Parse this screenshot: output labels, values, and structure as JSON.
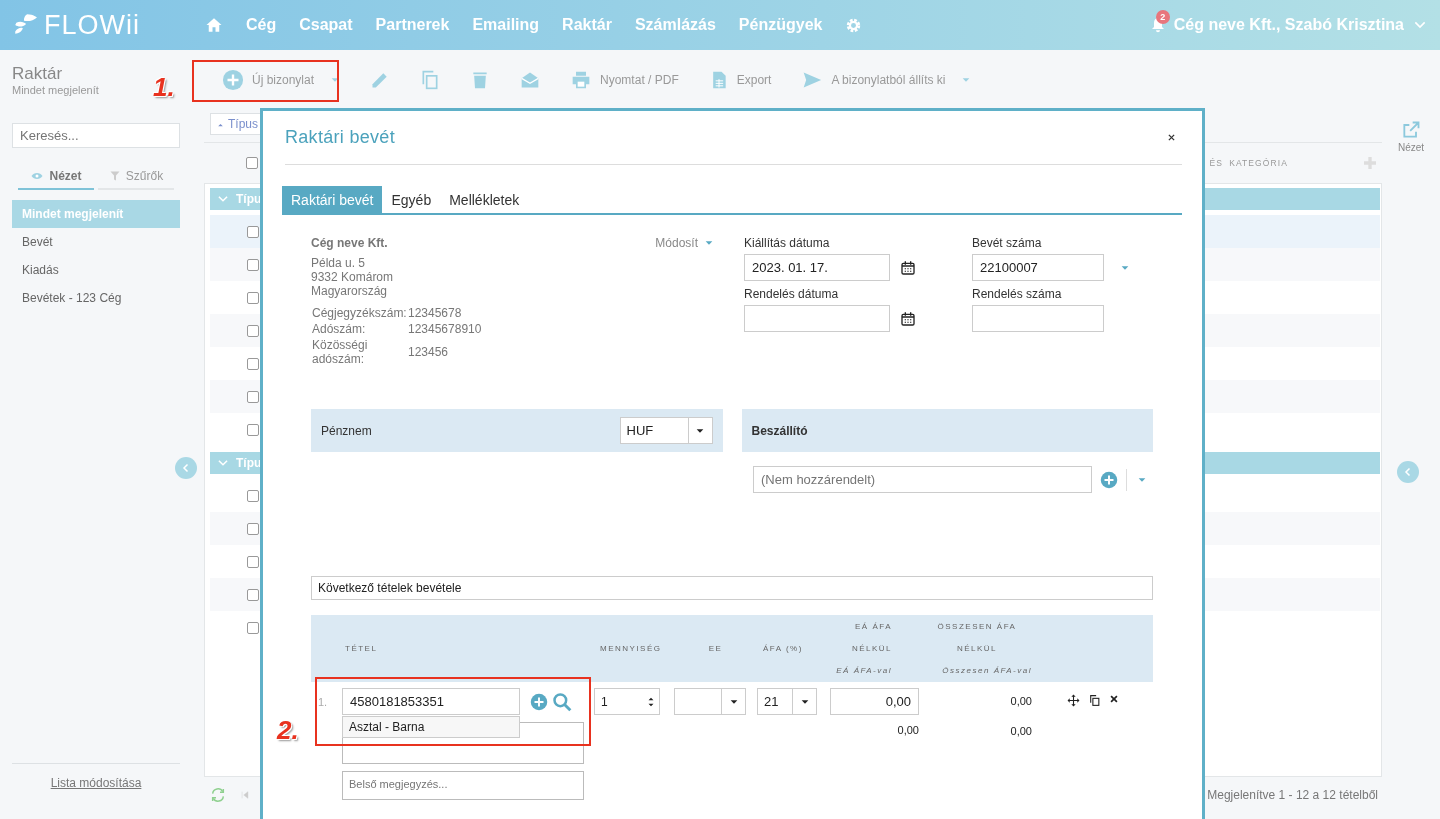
{
  "nav": {
    "logo": "FLOWii",
    "items": [
      "Cég",
      "Csapat",
      "Partnerek",
      "Emailing",
      "Raktár",
      "Számlázás",
      "Pénzügyek"
    ],
    "notification_count": "2",
    "user": "Cég neve Kft., Szabó Krisztina"
  },
  "page": {
    "title": "Raktár",
    "subtitle": "Mindet megjelenít"
  },
  "toolbar": [
    {
      "kind": "new",
      "label": "Új bizonylat"
    },
    {
      "kind": "edit"
    },
    {
      "kind": "copy"
    },
    {
      "kind": "delete"
    },
    {
      "kind": "email"
    },
    {
      "kind": "print",
      "label": "Nyomtat / PDF"
    },
    {
      "kind": "export",
      "label": "Export"
    },
    {
      "kind": "issue",
      "label": "A bizonylatból állíts ki"
    }
  ],
  "sidebar": {
    "search_placeholder": "Keresés...",
    "tabs": [
      {
        "label": "Nézet",
        "kind": "view",
        "selected": true
      },
      {
        "label": "Szűrők",
        "kind": "filter",
        "selected": false
      }
    ],
    "items": [
      {
        "label": "Mindet megjelenít",
        "selected": true
      },
      {
        "label": "Bevét",
        "selected": false
      },
      {
        "label": "Kiadás",
        "selected": false
      },
      {
        "label": "Bevétek - 123 Cég",
        "selected": false
      }
    ],
    "footer_link": "Lista módosítása"
  },
  "list": {
    "sort": "Típus",
    "select_all": {
      "checked": false
    },
    "columns": [
      "ÉS",
      "KATEGÓRIA"
    ],
    "groups": [
      {
        "label": "Típu",
        "rows": [
          {
            "checked": false
          },
          {
            "checked": false
          },
          {
            "checked": false
          },
          {
            "checked": false
          },
          {
            "checked": false
          },
          {
            "checked": false
          },
          {
            "checked": false
          }
        ]
      },
      {
        "label": "Típu",
        "rows": [
          {
            "checked": false
          },
          {
            "checked": false
          },
          {
            "checked": false
          },
          {
            "checked": false
          },
          {
            "checked": false
          }
        ]
      }
    ],
    "footer": "Megjelenítve 1 - 12 a 12 tételből"
  },
  "right_panel": {
    "label": "Nézet"
  },
  "modal": {
    "title": "Raktári bevét",
    "tabs": [
      {
        "label": "Raktári bevét",
        "selected": true
      },
      {
        "label": "Egyéb",
        "selected": false
      },
      {
        "label": "Mellékletek",
        "selected": false
      }
    ],
    "company": {
      "name": "Cég neve Kft.",
      "action": "Módosít",
      "address": [
        "Példa u. 5",
        "9332 Komárom",
        "Magyarország"
      ],
      "ids": [
        {
          "label": "Cégjegyzékszám:",
          "value": "12345678"
        },
        {
          "label": "Adószám:",
          "value": "12345678910"
        },
        {
          "label": "Közösségi adószám:",
          "value": "123456"
        }
      ]
    },
    "fields": [
      {
        "label": "Kiállítás dátuma",
        "value": "2023. 01. 17.",
        "kind": "date"
      },
      {
        "label": "Bevét száma",
        "value": "22100007",
        "kind": "number"
      },
      {
        "label": "Rendelés dátuma",
        "kind": "date"
      },
      {
        "label": "Rendelés száma",
        "kind": "text"
      }
    ],
    "currency": {
      "label": "Pénznem",
      "value": "HUF"
    },
    "supplier": {
      "label": "Beszállító",
      "placeholder": "(Nem hozzárendelt)"
    },
    "note": "Következő tételek bevétele",
    "columns": [
      {
        "label": "TÉTEL"
      },
      {
        "label": "MENNYISÉG"
      },
      {
        "label": "EE"
      },
      {
        "label": "ÁFA (%)"
      },
      {
        "label": "EÁ ÁFA NÉLKÜL",
        "sublabel": "EÁ ÁFA-val"
      },
      {
        "label": "ÖSSZESEN ÁFA NÉLKÜL",
        "sublabel": "Összesen ÁFA-val"
      }
    ],
    "items": [
      {
        "number": "1.",
        "code": "4580181853351",
        "suggestion": "Asztal - Barna",
        "quantity": "1",
        "vat": "21",
        "unit_price": "0,00",
        "total_net": "0,00",
        "unit_gross": "0,00",
        "total_gross": "0,00",
        "internal_note_placeholder": "Belső megjegyzés..."
      }
    ]
  },
  "annotations": [
    {
      "label": "1."
    },
    {
      "label": "2."
    }
  ]
}
